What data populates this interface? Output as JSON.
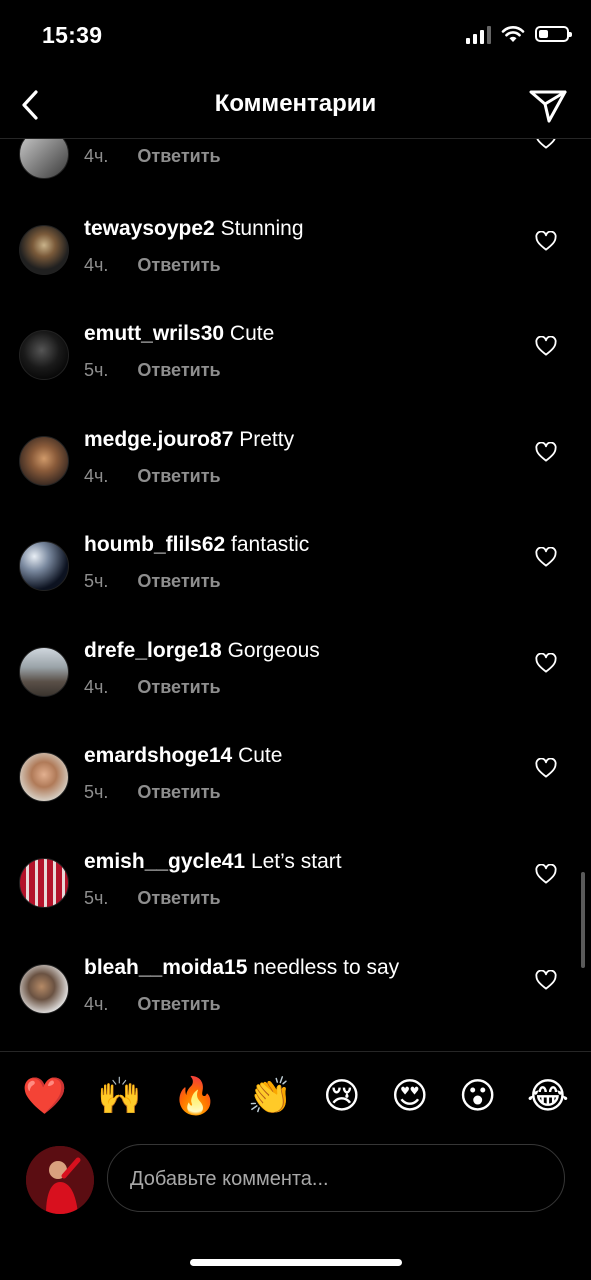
{
  "status_bar": {
    "time": "15:39"
  },
  "header": {
    "title": "Комментарии"
  },
  "comments": [
    {
      "username": "",
      "text": "",
      "time": "4ч.",
      "reply": "Ответить"
    },
    {
      "username": "tewaysoype2",
      "text": "Stunning",
      "time": "4ч.",
      "reply": "Ответить"
    },
    {
      "username": "emutt_wrils30",
      "text": "Cute",
      "time": "5ч.",
      "reply": "Ответить"
    },
    {
      "username": "medge.jouro87",
      "text": "Pretty",
      "time": "4ч.",
      "reply": "Ответить"
    },
    {
      "username": "houmb_flils62",
      "text": "fantastic",
      "time": "5ч.",
      "reply": "Ответить"
    },
    {
      "username": "drefe_lorge18",
      "text": "Gorgeous",
      "time": "4ч.",
      "reply": "Ответить"
    },
    {
      "username": "emardshoge14",
      "text": "Cute",
      "time": "5ч.",
      "reply": "Ответить"
    },
    {
      "username": "emish__gycle41",
      "text": "Let’s start",
      "time": "5ч.",
      "reply": "Ответить"
    },
    {
      "username": "bleah__moida15",
      "text": "needless to say",
      "time": "4ч.",
      "reply": "Ответить"
    }
  ],
  "emoji_bar": [
    "❤️",
    "🙌",
    "🔥",
    "👏",
    "😢",
    "😍",
    "😮",
    "😂"
  ],
  "composer": {
    "placeholder": "Добавьте коммента..."
  },
  "colors": {
    "background": "#000000",
    "secondary_text": "#8e8e8e",
    "divider": "#262626"
  }
}
